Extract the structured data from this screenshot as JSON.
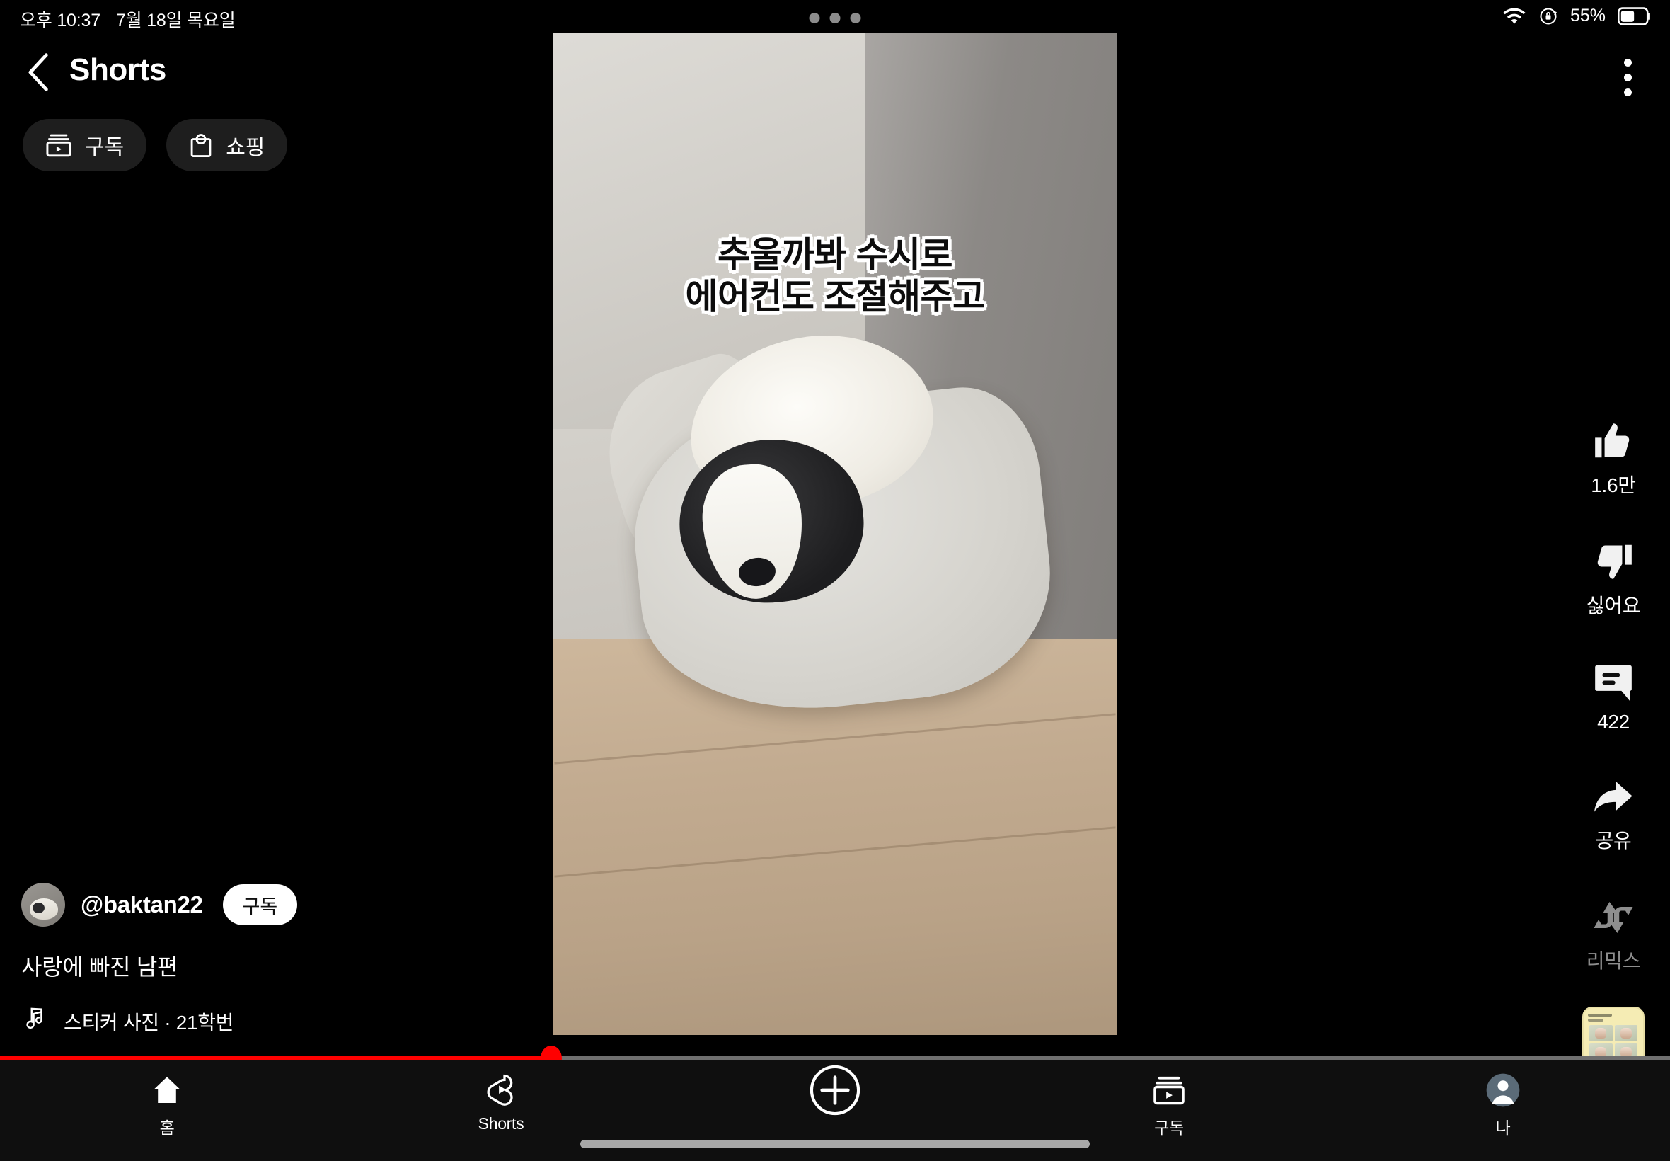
{
  "status_bar": {
    "time": "오후 10:37",
    "date": "7월 18일 목요일",
    "battery_percent": "55%",
    "wifi_icon": "wifi-icon",
    "rotation_lock_icon": "rotation-lock-icon",
    "battery_icon": "battery-icon",
    "camera_dots_icon": "camera-dots-icon"
  },
  "header": {
    "back_icon": "back-chevron-icon",
    "title": "Shorts",
    "more_icon": "more-vertical-icon"
  },
  "chips": [
    {
      "label": "구독",
      "icon": "subscriptions-icon"
    },
    {
      "label": "쇼핑",
      "icon": "shopping-bag-icon"
    }
  ],
  "video": {
    "caption_line1": "추울까봐 수시로",
    "caption_line2": "에어컨도 조절해주고",
    "scene_description": "강아지가 수건 위에서 자는 영상"
  },
  "actions": {
    "like": {
      "label": "1.6만",
      "icon": "thumbs-up-icon"
    },
    "dislike": {
      "label": "싫어요",
      "icon": "thumbs-down-icon"
    },
    "comments": {
      "label": "422",
      "icon": "comment-icon"
    },
    "share": {
      "label": "공유",
      "icon": "share-icon"
    },
    "remix": {
      "label": "리믹스",
      "icon": "remix-icon"
    },
    "sound_thumbnail": {
      "icon": "sound-thumbnail"
    }
  },
  "meta": {
    "avatar_icon": "channel-avatar",
    "channel": "@baktan22",
    "subscribe_label": "구독",
    "video_title": "사랑에 빠진 남편",
    "music_icon": "music-note-icon",
    "music_text": "스티커 사진 · 21학번"
  },
  "progress": {
    "percent": 33
  },
  "bottom_nav": [
    {
      "label": "홈",
      "icon": "home-icon"
    },
    {
      "label": "Shorts",
      "icon": "shorts-icon"
    },
    {
      "label": "",
      "icon": "create-plus-icon"
    },
    {
      "label": "구독",
      "icon": "subscriptions-nav-icon"
    },
    {
      "label": "나",
      "icon": "account-avatar-icon"
    }
  ],
  "colors": {
    "accent_red": "#ff0000",
    "background": "#000000",
    "nav_background": "#0f0f0f",
    "chip_background": "#1e1e1e"
  }
}
